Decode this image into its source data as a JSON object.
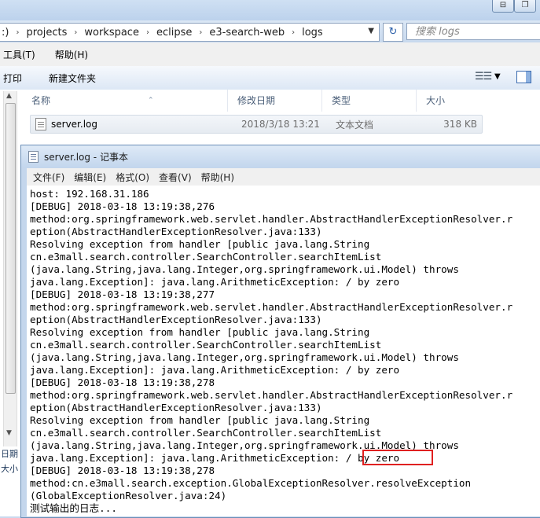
{
  "explorer": {
    "window_buttons": [
      "⊟",
      "❐"
    ],
    "address": {
      "segments": [
        ":)",
        "projects",
        "workspace",
        "eclipse",
        "e3-search-web",
        "logs"
      ],
      "separator": "›",
      "dropdown": "▼"
    },
    "refresh_icon": "↻",
    "search_placeholder": "搜索 logs",
    "menu": [
      "工具(T)",
      "帮助(H)"
    ],
    "toolbar": {
      "print": "打印",
      "new_folder": "新建文件夹",
      "view_icon": "☰☰",
      "view_dropdown": "▼"
    },
    "columns": {
      "name": "名称",
      "date_modified": "修改日期",
      "type": "类型",
      "size": "大小"
    },
    "files": [
      {
        "name": "server.log",
        "date_modified": "2018/3/18 13:21",
        "type": "文本文档",
        "size": "318 KB"
      }
    ],
    "left_panel_fragments": [
      "日期",
      "大小"
    ],
    "scroll_up": "▲",
    "scroll_down": "▼"
  },
  "notepad": {
    "title": "server.log - 记事本",
    "menu": [
      "文件(F)",
      "编辑(E)",
      "格式(O)",
      "查看(V)",
      "帮助(H)"
    ],
    "lines": [
      "host: 192.168.31.186",
      "[DEBUG] 2018-03-18 13:19:38,276",
      "method:org.springframework.web.servlet.handler.AbstractHandlerExceptionResolver.r",
      "eption(AbstractHandlerExceptionResolver.java:133)",
      "Resolving exception from handler [public java.lang.String",
      "cn.e3mall.search.controller.SearchController.searchItemList",
      "(java.lang.String,java.lang.Integer,org.springframework.ui.Model) throws",
      "java.lang.Exception]: java.lang.ArithmeticException: / by zero",
      "[DEBUG] 2018-03-18 13:19:38,277",
      "method:org.springframework.web.servlet.handler.AbstractHandlerExceptionResolver.r",
      "eption(AbstractHandlerExceptionResolver.java:133)",
      "Resolving exception from handler [public java.lang.String",
      "cn.e3mall.search.controller.SearchController.searchItemList",
      "(java.lang.String,java.lang.Integer,org.springframework.ui.Model) throws",
      "java.lang.Exception]: java.lang.ArithmeticException: / by zero",
      "[DEBUG] 2018-03-18 13:19:38,278",
      "method:org.springframework.web.servlet.handler.AbstractHandlerExceptionResolver.r",
      "eption(AbstractHandlerExceptionResolver.java:133)",
      "Resolving exception from handler [public java.lang.String",
      "cn.e3mall.search.controller.SearchController.searchItemList",
      "(java.lang.String,java.lang.Integer,org.springframework.ui.Model) throws",
      "java.lang.Exception]: java.lang.ArithmeticException: / by zero",
      "[DEBUG] 2018-03-18 13:19:38,278",
      "method:cn.e3mall.search.exception.GlobalExceptionResolver.resolveException",
      "(GlobalExceptionResolver.java:24)",
      "测试输出的日志..."
    ],
    "highlight_color": "#e02020"
  }
}
